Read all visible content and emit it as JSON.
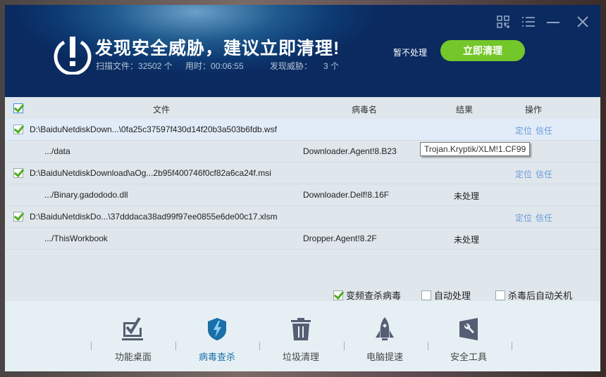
{
  "header": {
    "title": "发现安全威胁，建议立即清理!",
    "scanned_label": "扫描文件：",
    "scanned_count": "32502 个",
    "time_label": "用时：",
    "time_value": "00:06:55",
    "threats_label": "发现威胁：",
    "threats_count": "3 个",
    "later_button": "暂不处理",
    "clean_button": "立即清理"
  },
  "table": {
    "columns": [
      "文件",
      "病毒名",
      "结果",
      "操作"
    ],
    "groups": [
      {
        "path": "D:\\BaiduNetdiskDown...\\0fa25c37597f430d14f20b3a503b6fdb.wsf",
        "sub": ".../data",
        "virus": "Downloader.Agent!8.B23",
        "result": "",
        "actions": [
          "定位",
          "信任"
        ]
      },
      {
        "path": "D:\\BaiduNetdiskDownload\\aOg...2b95f400746f0cf82a6ca24f.msi",
        "sub": ".../Binary.gadododo.dll",
        "virus": "Downloader.Delf!8.16F",
        "result": "未处理",
        "actions": [
          "定位",
          "信任"
        ]
      },
      {
        "path": "D:\\BaiduNetdiskDo...\\37dddaca38ad99f97ee0855e6de00c17.xlsm",
        "sub": ".../ThisWorkbook",
        "virus": "Dropper.Agent!8.2F",
        "result": "未处理",
        "actions": [
          "定位",
          "信任"
        ]
      }
    ],
    "tooltip": "Trojan.Kryptik/XLM!1.CF99"
  },
  "options": [
    {
      "label": "变频查杀病毒",
      "checked": true
    },
    {
      "label": "自动处理",
      "checked": false
    },
    {
      "label": "杀毒后自动关机",
      "checked": false
    }
  ],
  "toolbar": [
    {
      "label": "功能桌面",
      "icon": "checkbox-icon"
    },
    {
      "label": "病毒查杀",
      "icon": "shield-icon"
    },
    {
      "label": "垃圾清理",
      "icon": "trash-icon"
    },
    {
      "label": "电脑提速",
      "icon": "rocket-icon"
    },
    {
      "label": "安全工具",
      "icon": "wrench-icon"
    }
  ],
  "colors": {
    "accent": "#74c72a",
    "link": "#6a9ad8",
    "active": "#1a6fa8"
  }
}
